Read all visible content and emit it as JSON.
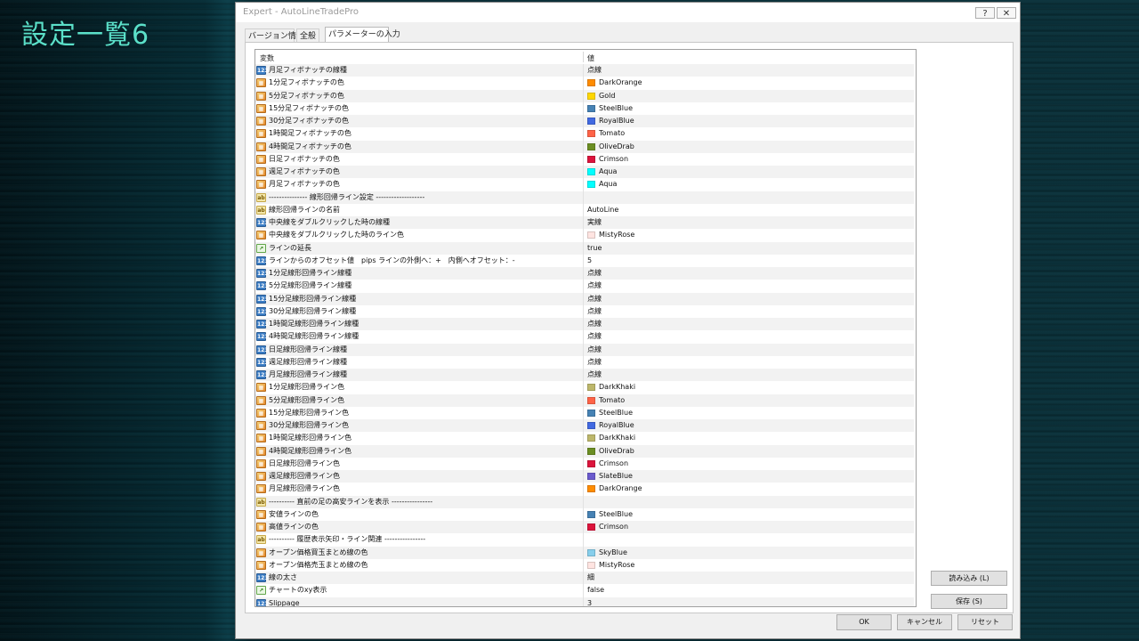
{
  "slide": {
    "title": "設定一覧6"
  },
  "window": {
    "title": "Expert - AutoLineTradePro",
    "help_button": "?",
    "close_button": "✕"
  },
  "tabs": [
    {
      "label": "バージョン情報",
      "active": false
    },
    {
      "label": "全般",
      "active": false
    },
    {
      "label": "パラメーターの入力",
      "active": true
    }
  ],
  "grid": {
    "columns": [
      "変数",
      "値"
    ],
    "rows": [
      {
        "icon": "num",
        "name": "月足フィボナッチの線種",
        "value": "点線"
      },
      {
        "icon": "col",
        "name": "1分足フィボナッチの色",
        "value": "DarkOrange",
        "color": "#ff8c00"
      },
      {
        "icon": "col",
        "name": "5分足フィボナッチの色",
        "value": "Gold",
        "color": "#ffd700"
      },
      {
        "icon": "col",
        "name": "15分足フィボナッチの色",
        "value": "SteelBlue",
        "color": "#4682b4"
      },
      {
        "icon": "col",
        "name": "30分足フィボナッチの色",
        "value": "RoyalBlue",
        "color": "#4169e1"
      },
      {
        "icon": "col",
        "name": "1時間足フィボナッチの色",
        "value": "Tomato",
        "color": "#ff6347"
      },
      {
        "icon": "col",
        "name": "4時間足フィボナッチの色",
        "value": "OliveDrab",
        "color": "#6b8e23"
      },
      {
        "icon": "col",
        "name": "日足フィボナッチの色",
        "value": "Crimson",
        "color": "#dc143c"
      },
      {
        "icon": "col",
        "name": "週足フィボナッチの色",
        "value": "Aqua",
        "color": "#00ffff"
      },
      {
        "icon": "col",
        "name": "月足フィボナッチの色",
        "value": "Aqua",
        "color": "#00ffff"
      },
      {
        "icon": "str",
        "name": "--------------- 線形回帰ライン設定 -------------------",
        "value": ""
      },
      {
        "icon": "str",
        "name": "線形回帰ラインの名前",
        "value": "AutoLine"
      },
      {
        "icon": "num",
        "name": "中央線をダブルクリックした時の線種",
        "value": "実線"
      },
      {
        "icon": "col",
        "name": "中央線をダブルクリックした時のライン色",
        "value": "MistyRose",
        "color": "#ffe4e1"
      },
      {
        "icon": "bool",
        "name": "ラインの延長",
        "value": "true"
      },
      {
        "icon": "num",
        "name": "ラインからのオフセット値　pips ラインの外側へ：+　内側へオフセット：-",
        "value": "5"
      },
      {
        "icon": "num",
        "name": "1分足線形回帰ライン線種",
        "value": "点線"
      },
      {
        "icon": "num",
        "name": "5分足線形回帰ライン線種",
        "value": "点線"
      },
      {
        "icon": "num",
        "name": "15分足線形回帰ライン線種",
        "value": "点線"
      },
      {
        "icon": "num",
        "name": "30分足線形回帰ライン線種",
        "value": "点線"
      },
      {
        "icon": "num",
        "name": "1時間足線形回帰ライン線種",
        "value": "点線"
      },
      {
        "icon": "num",
        "name": "4時間足線形回帰ライン線種",
        "value": "点線"
      },
      {
        "icon": "num",
        "name": "日足線形回帰ライン線種",
        "value": "点線"
      },
      {
        "icon": "num",
        "name": "週足線形回帰ライン線種",
        "value": "点線"
      },
      {
        "icon": "num",
        "name": "月足線形回帰ライン線種",
        "value": "点線"
      },
      {
        "icon": "col",
        "name": "1分足線形回帰ライン色",
        "value": "DarkKhaki",
        "color": "#bdb76b"
      },
      {
        "icon": "col",
        "name": "5分足線形回帰ライン色",
        "value": "Tomato",
        "color": "#ff6347"
      },
      {
        "icon": "col",
        "name": "15分足線形回帰ライン色",
        "value": "SteelBlue",
        "color": "#4682b4"
      },
      {
        "icon": "col",
        "name": "30分足線形回帰ライン色",
        "value": "RoyalBlue",
        "color": "#4169e1"
      },
      {
        "icon": "col",
        "name": "1時間足線形回帰ライン色",
        "value": "DarkKhaki",
        "color": "#bdb76b"
      },
      {
        "icon": "col",
        "name": "4時間足線形回帰ライン色",
        "value": "OliveDrab",
        "color": "#6b8e23"
      },
      {
        "icon": "col",
        "name": "日足線形回帰ライン色",
        "value": "Crimson",
        "color": "#dc143c"
      },
      {
        "icon": "col",
        "name": "週足線形回帰ライン色",
        "value": "SlateBlue",
        "color": "#6a5acd"
      },
      {
        "icon": "col",
        "name": "月足線形回帰ライン色",
        "value": "DarkOrange",
        "color": "#ff8c00"
      },
      {
        "icon": "str",
        "name": "---------- 直前の足の高安ラインを表示 ----------------",
        "value": ""
      },
      {
        "icon": "col",
        "name": "安値ラインの色",
        "value": "SteelBlue",
        "color": "#4682b4"
      },
      {
        "icon": "col",
        "name": "高値ラインの色",
        "value": "Crimson",
        "color": "#dc143c"
      },
      {
        "icon": "str",
        "name": "---------- 履歴表示矢印・ライン関連 ----------------",
        "value": ""
      },
      {
        "icon": "col",
        "name": "オープン価格買玉まとめ線の色",
        "value": "SkyBlue",
        "color": "#87ceeb"
      },
      {
        "icon": "col",
        "name": "オープン価格売玉まとめ線の色",
        "value": "MistyRose",
        "color": "#ffe4e1"
      },
      {
        "icon": "num",
        "name": "線の太さ",
        "value": "細"
      },
      {
        "icon": "bool",
        "name": "チャートのxy表示",
        "value": "false"
      },
      {
        "icon": "num",
        "name": "Slippage",
        "value": "3"
      }
    ]
  },
  "side_buttons": {
    "load": "読み込み (L)",
    "save": "保存 (S)"
  },
  "buttons": {
    "ok": "OK",
    "cancel": "キャンセル",
    "reset": "リセット"
  },
  "icon_glyphs": {
    "num": "123",
    "col": "▦",
    "str": "ab",
    "bool": "↗"
  }
}
